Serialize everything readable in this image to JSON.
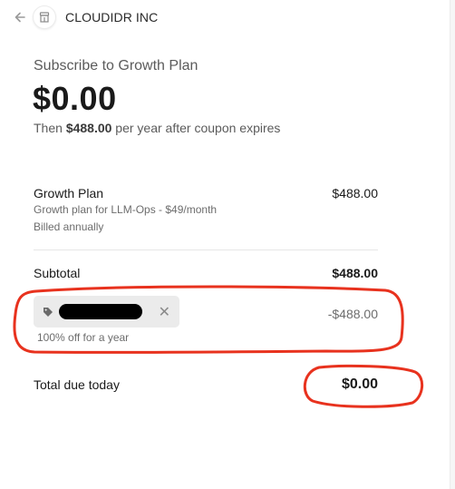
{
  "header": {
    "company": "CLOUDIDR INC"
  },
  "summary": {
    "subscribe_title": "Subscribe to Growth Plan",
    "price": "$0.00",
    "then_prefix": "Then ",
    "then_amount": "$488.00",
    "then_suffix": " per year after coupon expires"
  },
  "line_item": {
    "name": "Growth Plan",
    "description": "Growth plan for LLM-Ops - $49/month",
    "billing": "Billed annually",
    "amount": "$488.00"
  },
  "subtotal": {
    "label": "Subtotal",
    "amount": "$488.00"
  },
  "coupon": {
    "note": "100% off for a year",
    "discount": "-$488.00",
    "remove_glyph": "✕"
  },
  "total": {
    "label": "Total due today",
    "amount": "$0.00"
  },
  "icons": [
    "back-arrow-icon",
    "store-icon",
    "tag-icon",
    "close-icon"
  ],
  "colors": {
    "annotation": "#e8321e",
    "coupon_pill": "#ebebeb",
    "redaction": "#000000"
  }
}
